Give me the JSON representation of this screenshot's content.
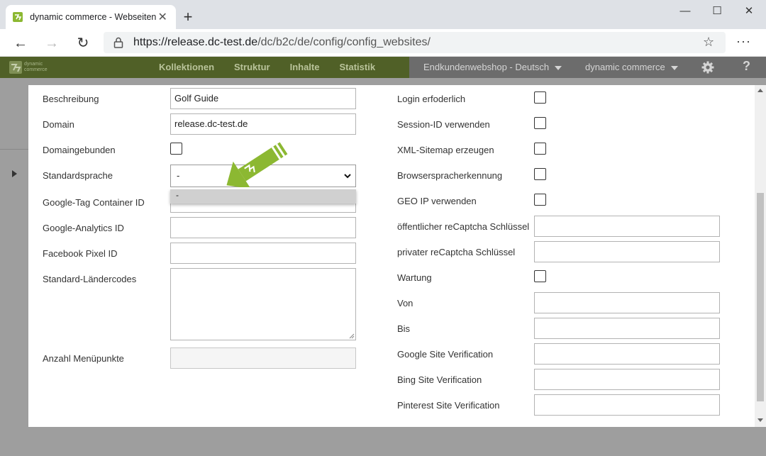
{
  "browser": {
    "tab_title": "dynamic commerce - Webseiten",
    "tab_close": "✕",
    "new_tab": "+",
    "window_controls": {
      "minimize": "—",
      "maximize": "☐",
      "close": "✕"
    },
    "url_host": "https://release.dc-test.de",
    "url_path": "/dc/b2c/de/config/config_websites/",
    "back": "←",
    "forward": "→",
    "reload": "↻",
    "favorite": "☆",
    "more": "···"
  },
  "app_nav": {
    "logo_line1": "dynamic",
    "logo_line2": "commerce",
    "links": [
      "Kollektionen",
      "Struktur",
      "Inhalte",
      "Statistik"
    ],
    "shop_selector": "Endkundenwebshop - Deutsch",
    "company_selector": "dynamic commerce",
    "help": "?"
  },
  "form": {
    "left": {
      "description_label": "Beschreibung",
      "description_value": "Golf Guide",
      "domain_label": "Domain",
      "domain_value": "release.dc-test.de",
      "domain_bound_label": "Domaingebunden",
      "default_language_label": "Standardsprache",
      "default_language_value": "-",
      "default_language_option": "-",
      "gtm_label": "Google-Tag Container ID",
      "analytics_label": "Google-Analytics ID",
      "facebook_label": "Facebook Pixel ID",
      "country_codes_label": "Standard-Ländercodes",
      "menu_count_label": "Anzahl Menüpunkte"
    },
    "right": {
      "login_required_label": "Login erfoderlich",
      "session_id_label": "Session-ID verwenden",
      "xml_sitemap_label": "XML-Sitemap erzeugen",
      "browser_lang_label": "Browserspracherkennung",
      "geo_ip_label": "GEO IP verwenden",
      "recaptcha_public_label": "öffentlicher reCaptcha Schlüssel",
      "recaptcha_private_label": "privater reCaptcha Schlüssel",
      "maintenance_label": "Wartung",
      "from_label": "Von",
      "to_label": "Bis",
      "google_verification_label": "Google Site Verification",
      "bing_verification_label": "Bing Site Verification",
      "pinterest_verification_label": "Pinterest Site Verification"
    }
  },
  "colors": {
    "app_nav": "#56662a",
    "brand_green": "#8cb832",
    "nav_right": "#6c6c6c"
  }
}
